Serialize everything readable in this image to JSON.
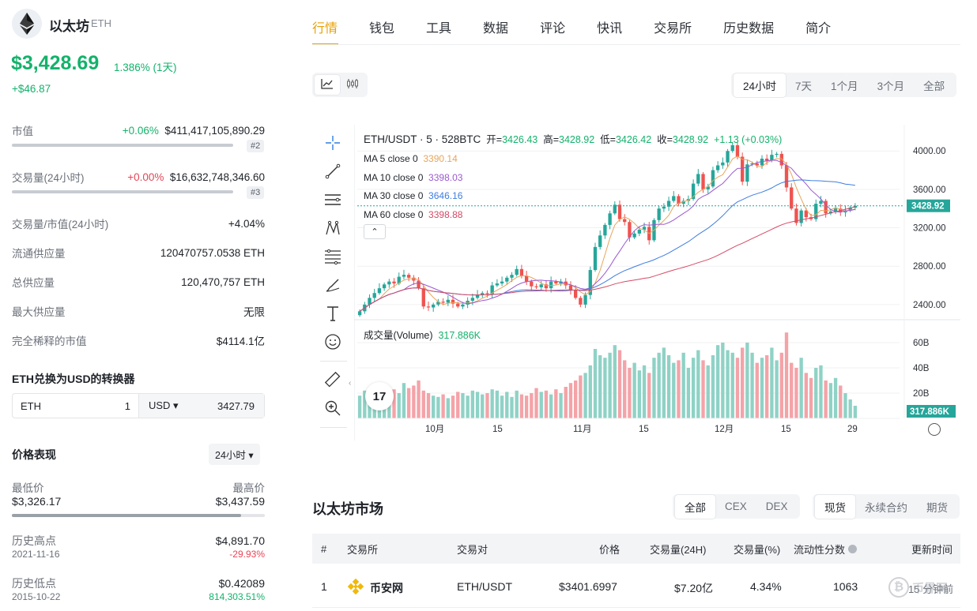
{
  "coin": {
    "name": "以太坊",
    "symbol": "ETH"
  },
  "price": {
    "value": "$3,428.69",
    "change_pct": "1.386% (1天)",
    "change_abs": "+$46.87"
  },
  "stats": [
    {
      "label": "市值",
      "change": "+0.06%",
      "value": "$411,417,105,890.29",
      "rank": "#2",
      "dir": "up"
    },
    {
      "label": "交易量(24小时)",
      "change": "+0.00%",
      "value": "$16,632,748,346.60",
      "rank": "#3",
      "dir": "down"
    }
  ],
  "info": [
    {
      "label": "交易量/市值(24小时)",
      "value": "+4.04%"
    },
    {
      "label": "流通供应量",
      "value": "120470757.0538 ETH"
    },
    {
      "label": "总供应量",
      "value": "120,470,757 ETH"
    },
    {
      "label": "最大供应量",
      "value": "无限"
    },
    {
      "label": "完全稀释的市值",
      "value": "$4114.1亿"
    }
  ],
  "converter": {
    "title": "ETH兑换为USD的转换器",
    "from": "ETH",
    "from_val": "1",
    "to": "USD ▾",
    "to_val": "3427.79"
  },
  "perf": {
    "title": "价格表现",
    "period": "24小时 ▾",
    "low_label": "最低价",
    "low": "$3,326.17",
    "high_label": "最高价",
    "high": "$3,437.59",
    "ath_label": "历史高点",
    "ath": "$4,891.70",
    "ath_date": "2021-11-16",
    "ath_pct": "-29.93%",
    "atl_label": "历史低点",
    "atl": "$0.42089",
    "atl_date": "2015-10-22",
    "atl_pct": "814,303.51%"
  },
  "nav": [
    "行情",
    "钱包",
    "工具",
    "数据",
    "评论",
    "快讯",
    "交易所",
    "历史数据",
    "简介"
  ],
  "ranges": [
    "24小时",
    "7天",
    "1个月",
    "3个月",
    "全部"
  ],
  "chart_header": {
    "pair": "ETH/USDT · 5 · 528BTC",
    "open_l": "开=",
    "open": "3426.43",
    "high_l": "高=",
    "high": "3428.92",
    "low_l": "低=",
    "low": "3426.42",
    "close_l": "收=",
    "close": "3428.92",
    "chg": "+1.13 (+0.03%)"
  },
  "ma_legend": [
    {
      "label": "MA 5 close 0",
      "value": "3390.14",
      "color": "#e8a55a"
    },
    {
      "label": "MA 10 close 0",
      "value": "3398.03",
      "color": "#9b59d0"
    },
    {
      "label": "MA 30 close 0",
      "value": "3646.16",
      "color": "#3f7de0"
    },
    {
      "label": "MA 60 close 0",
      "value": "3398.88",
      "color": "#d44a64"
    }
  ],
  "volume_label": "成交量(Volume)",
  "volume_value": "317.886K",
  "current_price_tag": "3428.92",
  "chart_data": {
    "type": "candlestick",
    "price_ticks": [
      "4000.00",
      "3600.00",
      "3200.00",
      "2800.00",
      "2400.00"
    ],
    "volume_ticks": [
      "60B",
      "40B",
      "20B"
    ],
    "x_ticks": [
      "10月",
      "15",
      "11月",
      "15",
      "12月",
      "15",
      "29"
    ],
    "ylim": [
      2300,
      4150
    ],
    "last_price": 3428.92,
    "closes": [
      2330,
      2400,
      2470,
      2520,
      2570,
      2610,
      2640,
      2620,
      2690,
      2710,
      2680,
      2650,
      2570,
      2380,
      2370,
      2400,
      2430,
      2420,
      2450,
      2410,
      2380,
      2400,
      2440,
      2470,
      2500,
      2520,
      2510,
      2600,
      2620,
      2640,
      2680,
      2710,
      2770,
      2700,
      2640,
      2590,
      2580,
      2610,
      2570,
      2640,
      2620,
      2640,
      2600,
      2550,
      2470,
      2400,
      2500,
      2760,
      3000,
      3120,
      3230,
      3350,
      3440,
      3290,
      3260,
      3100,
      3140,
      3180,
      3210,
      3070,
      3280,
      3400,
      3420,
      3480,
      3530,
      3450,
      3480,
      3500,
      3660,
      3760,
      3600,
      3630,
      3800,
      3850,
      3880,
      4000,
      4060,
      3940,
      3680,
      3860,
      3870,
      3850,
      3920,
      3900,
      3960,
      3970,
      3850,
      3620,
      3400,
      3250,
      3380,
      3310,
      3290,
      3450,
      3480,
      3350,
      3370,
      3400,
      3360,
      3380,
      3410,
      3429
    ],
    "volumes": [
      18,
      22,
      24,
      20,
      26,
      19,
      21,
      23,
      20,
      28,
      24,
      26,
      30,
      22,
      20,
      18,
      17,
      19,
      16,
      18,
      21,
      20,
      18,
      22,
      21,
      19,
      20,
      23,
      22,
      18,
      21,
      17,
      22,
      19,
      18,
      20,
      24,
      21,
      22,
      19,
      23,
      20,
      25,
      28,
      30,
      34,
      36,
      42,
      55,
      50,
      48,
      52,
      58,
      54,
      46,
      40,
      44,
      38,
      42,
      36,
      48,
      52,
      56,
      50,
      44,
      46,
      52,
      40,
      48,
      54,
      46,
      42,
      50,
      58,
      60,
      54,
      52,
      48,
      56,
      60,
      52,
      44,
      48,
      50,
      56,
      46,
      52,
      68,
      44,
      40,
      48,
      36,
      32,
      40,
      42,
      30,
      28,
      32,
      26,
      20,
      15,
      10
    ]
  }
}
